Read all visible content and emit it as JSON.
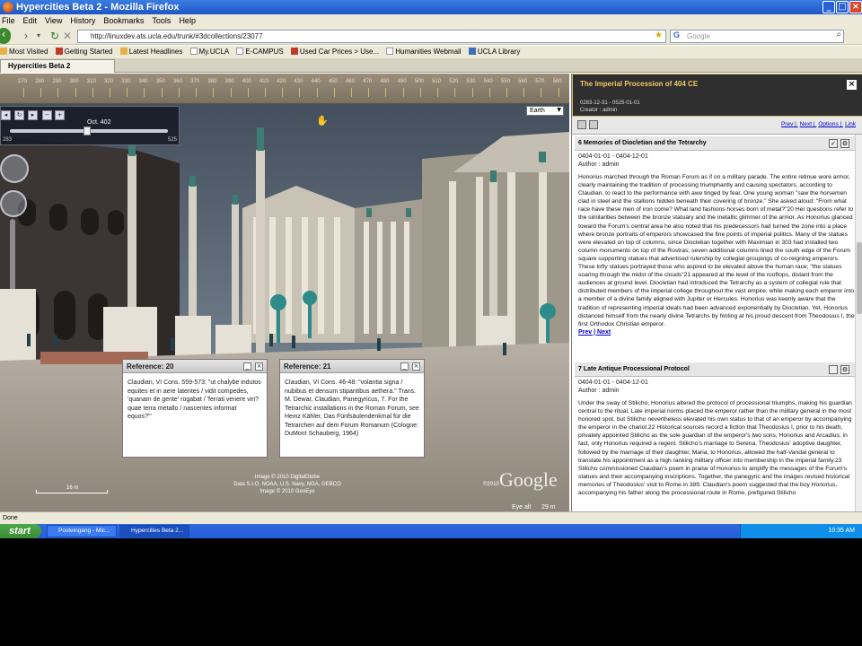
{
  "window": {
    "title": "Hypercities Beta 2 - Mozilla Firefox"
  },
  "menubar": [
    "File",
    "Edit",
    "View",
    "History",
    "Bookmarks",
    "Tools",
    "Help"
  ],
  "nav": {
    "url": "http://linuxdev.ats.ucla.edu/trunk/#3dcollections/23077",
    "search_placeholder": "Google"
  },
  "bookmarks": [
    "Most Visited",
    "Getting Started",
    "Latest Headlines",
    "My.UCLA",
    "E-CAMPUS",
    "Used Car Prices > Use...",
    "Humanities Webmail",
    "UCLA Library"
  ],
  "tab": {
    "label": "Hypercities Beta 2"
  },
  "timeline": {
    "ticks": [
      "270",
      "280",
      "290",
      "300",
      "310",
      "320",
      "330",
      "340",
      "350",
      "360",
      "370",
      "380",
      "390",
      "400",
      "410",
      "420",
      "430",
      "440",
      "450",
      "460",
      "470",
      "480",
      "490",
      "500",
      "510",
      "520",
      "530",
      "540",
      "550",
      "560",
      "570",
      "580",
      "590"
    ]
  },
  "timecontrol": {
    "date": "Oct. 402",
    "min": "283",
    "max": "525",
    "position": 0.49
  },
  "map": {
    "layer": "Earth",
    "credits": [
      "Image © 2010 DigitalGlobe",
      "Data S.I.O. NOAA, U.S. Navy, NGA, GEBCO",
      "Image © 2010 GeoEye"
    ],
    "google": "Google",
    "copyright": "©2010",
    "scale": "16 m",
    "eye_alt_label": "Eye alt",
    "eye_alt_value": "29 m"
  },
  "ref20": {
    "title": "Reference: 20",
    "body": "Claudian, VI Cons. 559-573: \"ut chalybe indutos equites et in aere latentes / vidit compedes, 'quanam de gente' rogabat / 'ferrati venere viri? quae terra metallo / nascentes informat equos?'\""
  },
  "ref21": {
    "title": "Reference: 21",
    "body": "Claudian, VI Cons. 46-48: \"volantia signa / nubibus et densum stipantibus aethera.\" Trans. M. Dewar, Claudian, Panegyricus, 7. For the Tetrarchic installations in the Roman Forum, see Heinz Kähler, Das Fünfsäulendenkmal für die Tetrarchen auf dem Forum Romanum (Cologne: DuMont Schauberg, 1964)"
  },
  "panel": {
    "title": "The Imperial Procession of 404 CE",
    "range": "0283-12-31 - 0525-01-01",
    "creator": "Creator : admin",
    "nav": [
      "Prev",
      "Next",
      "Options",
      "Link"
    ]
  },
  "entry6": {
    "title": "6 Memories of Diocletian and the Tetrarchy",
    "dates": "0404-01-01 - 0404-12-01",
    "author": "Author : admin",
    "body": "Honorius marched through the Roman Forum as if on a military parade.  The entire retinue wore armor, clearly maintaining the tradition of processing triumphantly and causing spectators, according to Claudian, to react to the performance with awe tinged by fear.  One young woman \"saw the horsemen clad in steel and the stallions hidden beneath their covering of bronze.\"  She asked aloud:  \"From what race have these men of iron come? What land fashions horses born of metal?\"20  Her questions refer to the similarities between the bronze statuary and the metallic glimmer of the armor.  As Honorius glanced toward the Forum's central area he also noted that his predecessors had turned the zone into a place where bronze portraits of emperors showcased the fine points of imperial politics.  Many of the statues were elevated on top of columns, since Diocletian together with Maximian in 303 had installed two column monuments on top of the Rostras; seven additional columns lined the south edge of the Forum square supporting statues that advertised rulership by collegial groupings of co-reigning emperors.  These lofty statues portrayed those who aspired to be elevated above the human race; \"the statues soaring through the midst of the clouds\"21 appeared at the level of the rooftops, distant from the audiences at ground level.  Diocletian had introduced the Tetrarchy as a system of collegial rule that distributed members of the imperial college throughout the vast empire, while making each emperor into a member of a divine family aligned with Jupiter or Hercules.  Honorius was keenly aware that the tradition of representing imperial ideals had been advanced exponentially by Diocletian.  Yet, Honorius distanced himself from the nearly divine Tetrarchs by hinting at his proud descent from Theodosius I, the first Orthodox Christian emperor.",
    "prev": "Prev",
    "next": "Next"
  },
  "entry7": {
    "title": "7 Late Antique Processional Protocol",
    "dates": "0404-01-01 - 0404-12-01",
    "author": "Author : admin",
    "body": "Under the sway of Stilicho, Honorius altered the protocol of processional triumphs, making his guardian central to the ritual.  Late imperial norms placed the emperor rather than the military general in the most honored spot, but Stilicho nevertheless elevated his own status to that of an emperor by accompanying the emperor in the chariot.22  Historical sources record a fiction that Theodosius I, prior to his death, privately appointed Stilicho as the sole guardian of the emperor's two sons, Honorius and Arcadius; in fact, only Honorius required a regent.  Stilicho's marriage to Serena, Theodosius' adoptive daughter, followed by the marriage of their daughter, Maria, to Honorius, allowed the half-Vandal general to translate his appointment as a high ranking military officer into membership in the imperial family.23  Stilicho commissioned Claudian's poem in praise of Honorius to amplify the messages of the Forum's statues and their accompanying inscriptions.  Together, the panegyric and the images revised historical memories of Theodosius' visit to Rome in 389.  Claudian's poem suggested that the boy Honorius, accompanying his father along the processional route in Rome, prefigured Stilicho"
  },
  "status": "Done",
  "taskbar": {
    "start": "start",
    "items": [
      "Posteingang - Mic...",
      "Hypercities Beta 2..."
    ],
    "clock": "10:35 AM"
  }
}
